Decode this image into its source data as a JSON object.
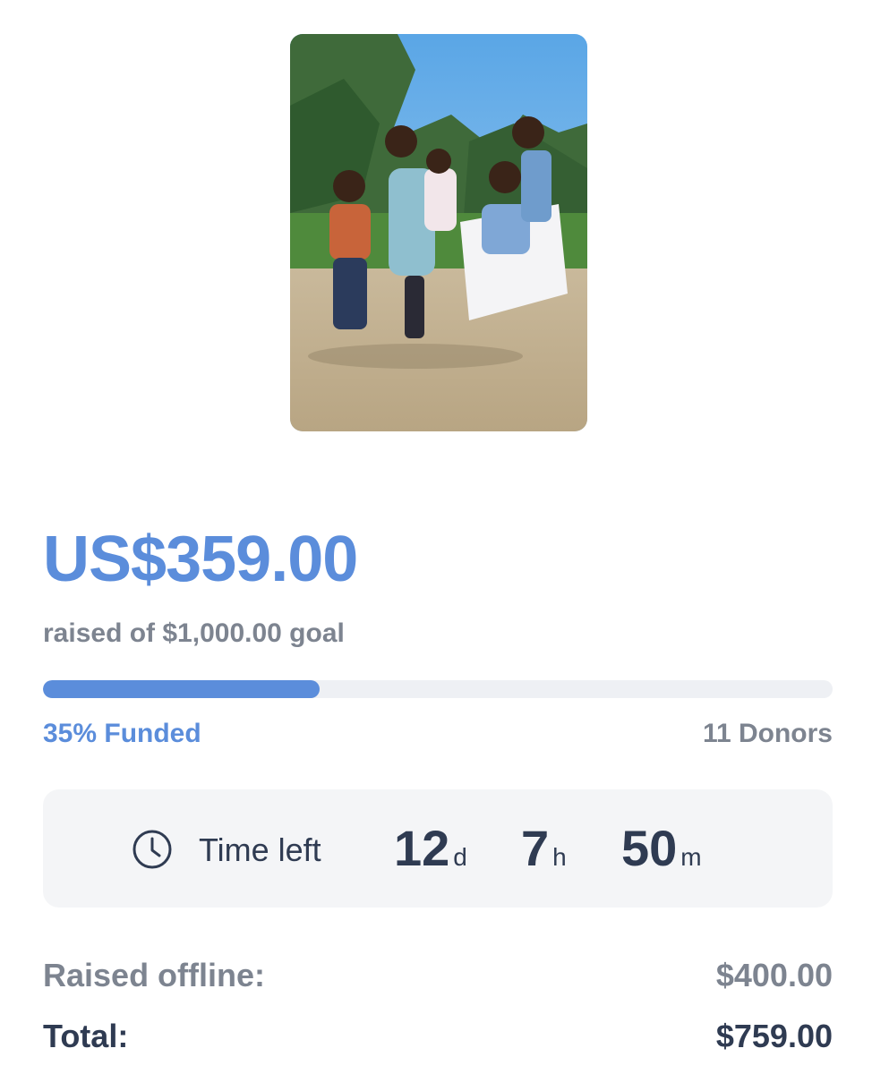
{
  "campaign": {
    "photo": "children-group-photo",
    "raised_amount": "US$359.00",
    "goal_text": "raised of $1,000.00 goal",
    "progress_fraction": 0.35,
    "funded_text": "35% Funded",
    "donors_text": "11 Donors"
  },
  "timer": {
    "icon": "clock-icon",
    "label": "Time left",
    "days": "12",
    "days_unit": "d",
    "hours": "7",
    "hours_unit": "h",
    "minutes": "50",
    "minutes_unit": "m"
  },
  "summary": {
    "offline_label": "Raised offline:",
    "offline_value": "$400.00",
    "total_label": "Total:",
    "total_value": "$759.00"
  },
  "colors": {
    "accent": "#5b8ddb",
    "muted": "#7d8490",
    "text": "#2f3b52",
    "panel": "#f4f5f7",
    "track": "#eef0f4"
  }
}
